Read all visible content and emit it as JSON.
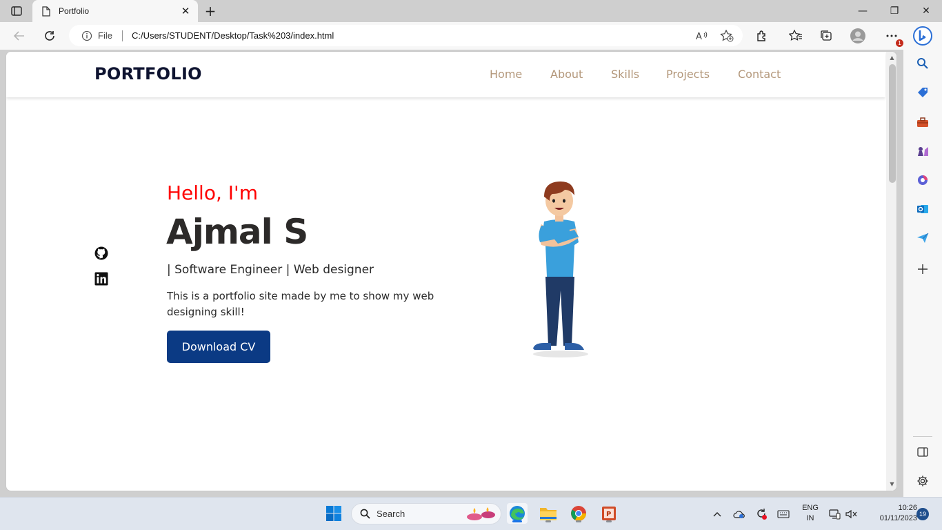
{
  "browser": {
    "tab": {
      "title": "Portfolio",
      "close_glyph": "✕"
    },
    "new_tab_glyph": "+",
    "window_controls": {
      "minimize": "—",
      "restore": "❐",
      "close": "✕"
    },
    "address": {
      "scheme_label": "File",
      "url": "C:/Users/STUDENT/Desktop/Task%203/index.html"
    },
    "profile_badge": "1"
  },
  "site": {
    "logo": "PORTFOLIO",
    "nav": [
      "Home",
      "About",
      "Skills",
      "Projects",
      "Contact"
    ],
    "hero": {
      "greeting": "Hello, I'm",
      "name": "Ajmal S",
      "role": "| Software Engineer | Web designer",
      "description": "This is a portfolio site made by me to show my web designing skill!",
      "cta": "Download CV"
    },
    "socials": [
      "github-icon",
      "linkedin-icon"
    ]
  },
  "taskbar": {
    "search_placeholder": "Search",
    "language": {
      "line1": "ENG",
      "line2": "IN"
    },
    "clock": {
      "time": "10:26",
      "date": "01/11/2023"
    },
    "notification_count": "19"
  },
  "colors": {
    "nav_link": "#b3977a",
    "greeting": "#ff0000",
    "cta_bg": "#0b3a84",
    "logo": "#0e1330"
  }
}
